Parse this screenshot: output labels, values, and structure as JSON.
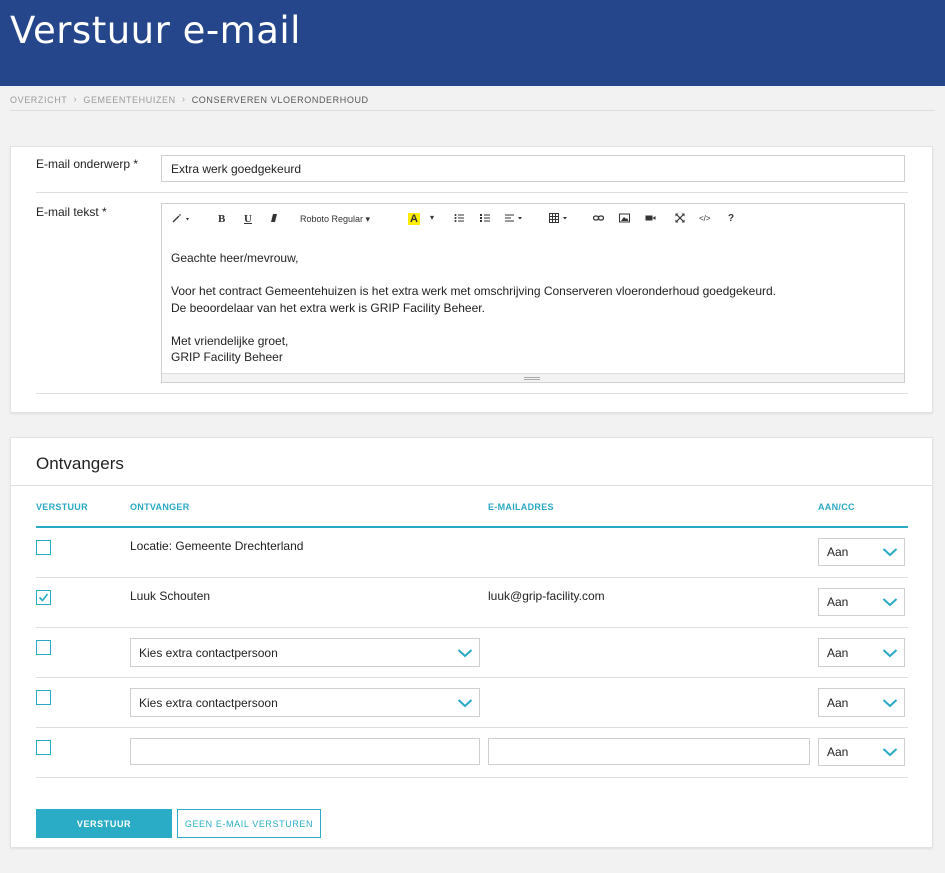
{
  "page": {
    "title": "Verstuur e-mail"
  },
  "breadcrumb": [
    "OVERZICHT",
    "GEMEENTEHUIZEN",
    "CONSERVEREN VLOERONDERHOUD"
  ],
  "email": {
    "subject_label": "E-mail onderwerp *",
    "subject_value": "Extra werk goedgekeurd",
    "body_label": "E-mail tekst *",
    "font_name": "Roboto Regular",
    "body_lines": [
      "Geachte heer/mevrouw,",
      "",
      "Voor het contract Gemeentehuizen is het extra werk met omschrijving Conserveren vloeronderhoud goedgekeurd.",
      "De beoordelaar van het extra werk is GRIP Facility Beheer.",
      "",
      "Met vriendelijke groet,",
      "GRIP Facility Beheer"
    ]
  },
  "toolbar": {
    "icons": [
      "magic-wand-icon",
      "bold-icon",
      "underline-icon",
      "eraser-icon",
      "font-dropdown",
      "highlight-icon",
      "bullet-list-icon",
      "numbered-list-icon",
      "align-icon",
      "table-icon",
      "link-icon",
      "image-icon",
      "video-icon",
      "fullscreen-icon",
      "code-icon",
      "help-icon"
    ],
    "bold": "B",
    "underline": "U",
    "highlight": "A",
    "code": "</>",
    "help": "?"
  },
  "recipients": {
    "title": "Ontvangers",
    "columns": {
      "send": "VERSTUUR",
      "recipient": "ONTVANGER",
      "email": "E-MAILADRES",
      "to_cc": "AAN/CC"
    },
    "rows": [
      {
        "checked": false,
        "recipient": "Locatie: Gemeente Drechterland",
        "email": "",
        "to_cc": "Aan"
      },
      {
        "checked": true,
        "recipient": "Luuk Schouten",
        "email": "luuk@grip-facility.com",
        "to_cc": "Aan"
      },
      {
        "checked": false,
        "recipient_select": "Kies extra contactpersoon",
        "to_cc": "Aan"
      },
      {
        "checked": false,
        "recipient_select": "Kies extra contactpersoon",
        "to_cc": "Aan"
      },
      {
        "checked": false,
        "recipient_input": "",
        "email_input": "",
        "to_cc": "Aan"
      }
    ]
  },
  "actions": {
    "send_label": "VERSTUUR",
    "no_email_label": "GEEN E-MAIL VERSTUREN"
  },
  "colors": {
    "header": "#26468c",
    "accent": "#2aa9c4"
  }
}
